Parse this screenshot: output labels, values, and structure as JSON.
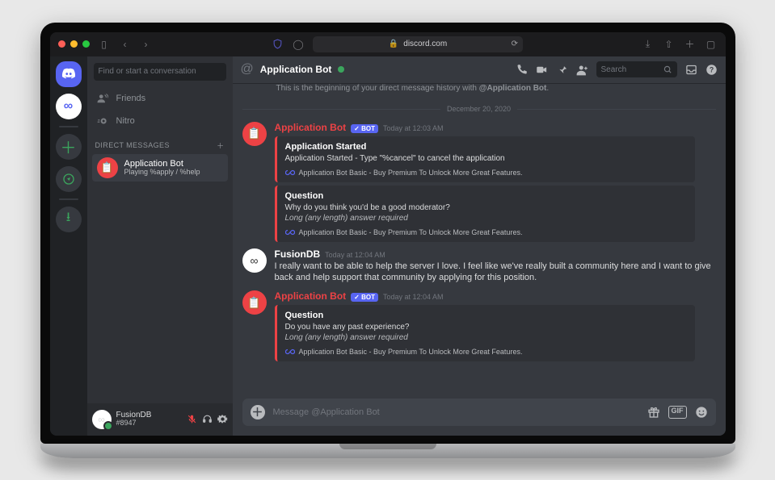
{
  "browser": {
    "url": "discord.com"
  },
  "header": {
    "title": "Application Bot",
    "search_placeholder": "Search"
  },
  "dm_column": {
    "search_placeholder": "Find or start a conversation",
    "friends_label": "Friends",
    "nitro_label": "Nitro",
    "dm_header": "DIRECT MESSAGES",
    "active_dm": {
      "name": "Application Bot",
      "status": "Playing %apply / %help"
    }
  },
  "user_panel": {
    "name": "FusionDB",
    "tag": "#8947"
  },
  "chat": {
    "beginning_prefix": "This is the beginning of your direct message history with ",
    "beginning_target": "@Application Bot",
    "beginning_suffix": ".",
    "date_divider": "December 20, 2020",
    "bot_badge": "✓ BOT",
    "footer_text": "Application Bot Basic - Buy Premium To Unlock More Great Features.",
    "messages": [
      {
        "author": "Application Bot",
        "is_bot": true,
        "ts": "Today at 12:03 AM",
        "embeds": [
          {
            "title": "Application Started",
            "desc": "Application Started - Type \"%cancel\" to cancel the application"
          },
          {
            "title": "Question",
            "desc": "Why do you think you'd be a good moderator?",
            "hint": "Long (any length) answer required"
          }
        ]
      },
      {
        "author": "FusionDB",
        "is_bot": false,
        "ts": "Today at 12:04 AM",
        "text": "I really want to be able to help the server I love. I feel like we've really built a community here and I want to give back and help support that community by applying for this position."
      },
      {
        "author": "Application Bot",
        "is_bot": true,
        "ts": "Today at 12:04 AM",
        "embeds": [
          {
            "title": "Question",
            "desc": "Do you have any past experience?",
            "hint": "Long (any length) answer required"
          }
        ]
      }
    ],
    "composer_placeholder": "Message @Application Bot"
  }
}
